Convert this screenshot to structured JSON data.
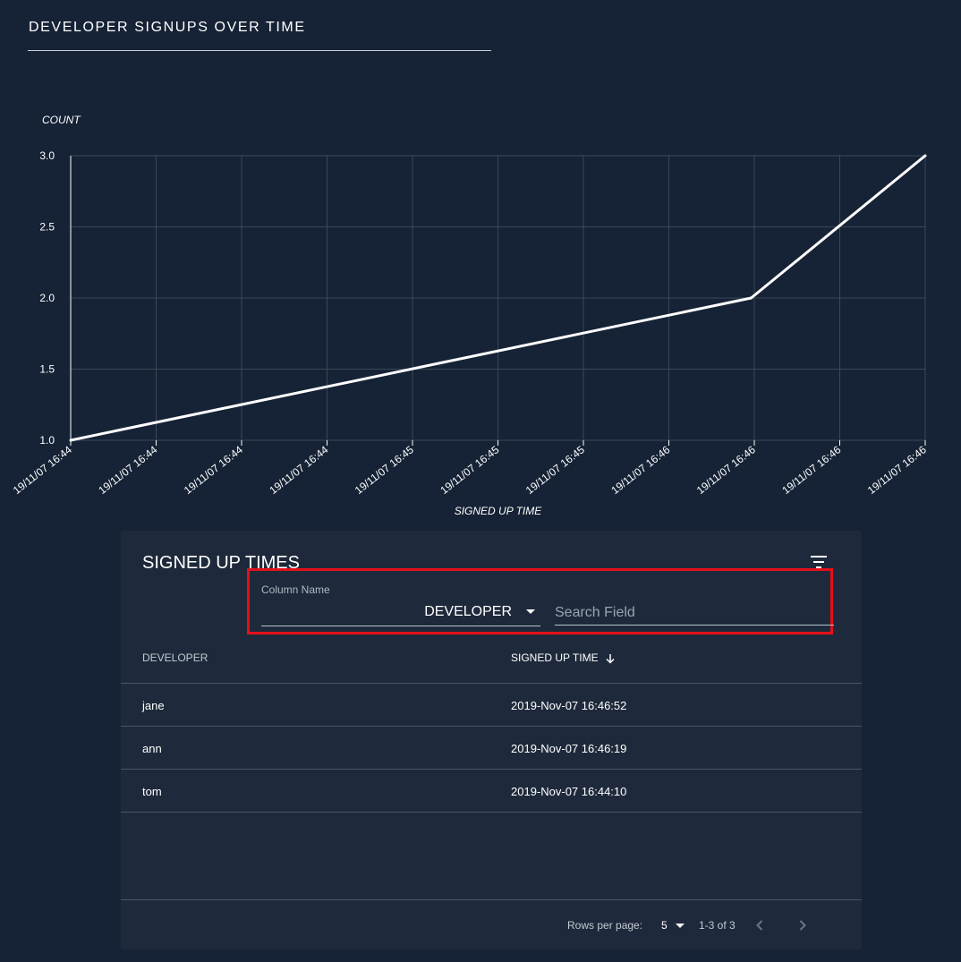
{
  "page": {
    "title": "DEVELOPER SIGNUPS OVER TIME"
  },
  "chart_data": {
    "type": "line",
    "title": "DEVELOPER SIGNUPS OVER TIME",
    "xlabel": "SIGNED UP TIME",
    "ylabel": "COUNT",
    "ylim": [
      1.0,
      3.0
    ],
    "y_ticks": [
      "1.0",
      "1.5",
      "2.0",
      "2.5",
      "3.0"
    ],
    "x_ticks": [
      "19/11/07 16:44",
      "19/11/07 16:44",
      "19/11/07 16:44",
      "19/11/07 16:44",
      "19/11/07 16:45",
      "19/11/07 16:45",
      "19/11/07 16:45",
      "19/11/07 16:46",
      "19/11/07 16:46",
      "19/11/07 16:46",
      "19/11/07 16:46"
    ],
    "xlim": [
      "2019-11-07 16:44:10",
      "2019-11-07 16:46:52"
    ],
    "grid": true,
    "series": [
      {
        "x": [
          "2019-11-07 16:44:10",
          "2019-11-07 16:46:19",
          "2019-11-07 16:46:52"
        ],
        "values": [
          1,
          2,
          3
        ]
      }
    ],
    "line_color": "#ffffff",
    "grid_color": "#3a4759"
  },
  "table": {
    "title": "SIGNED UP TIMES",
    "filter_icon": "filter-list-icon",
    "search": {
      "column_label": "Column Name",
      "column_value": "DEVELOPER",
      "placeholder": "Search Field",
      "value": ""
    },
    "headers": {
      "developer": "DEVELOPER",
      "signed_up_time": "SIGNED UP TIME"
    },
    "rows": [
      {
        "developer": "jane",
        "signed_up_time": "2019-Nov-07 16:46:52"
      },
      {
        "developer": "ann",
        "signed_up_time": "2019-Nov-07 16:46:19"
      },
      {
        "developer": "tom",
        "signed_up_time": "2019-Nov-07 16:44:10"
      }
    ],
    "footer": {
      "rows_per_page_label": "Rows per page:",
      "rows_per_page": "5",
      "range": "1-3 of 3"
    }
  },
  "colors": {
    "background": "#162336",
    "card": "#1e2a3b",
    "highlight": "#e40f1a"
  }
}
